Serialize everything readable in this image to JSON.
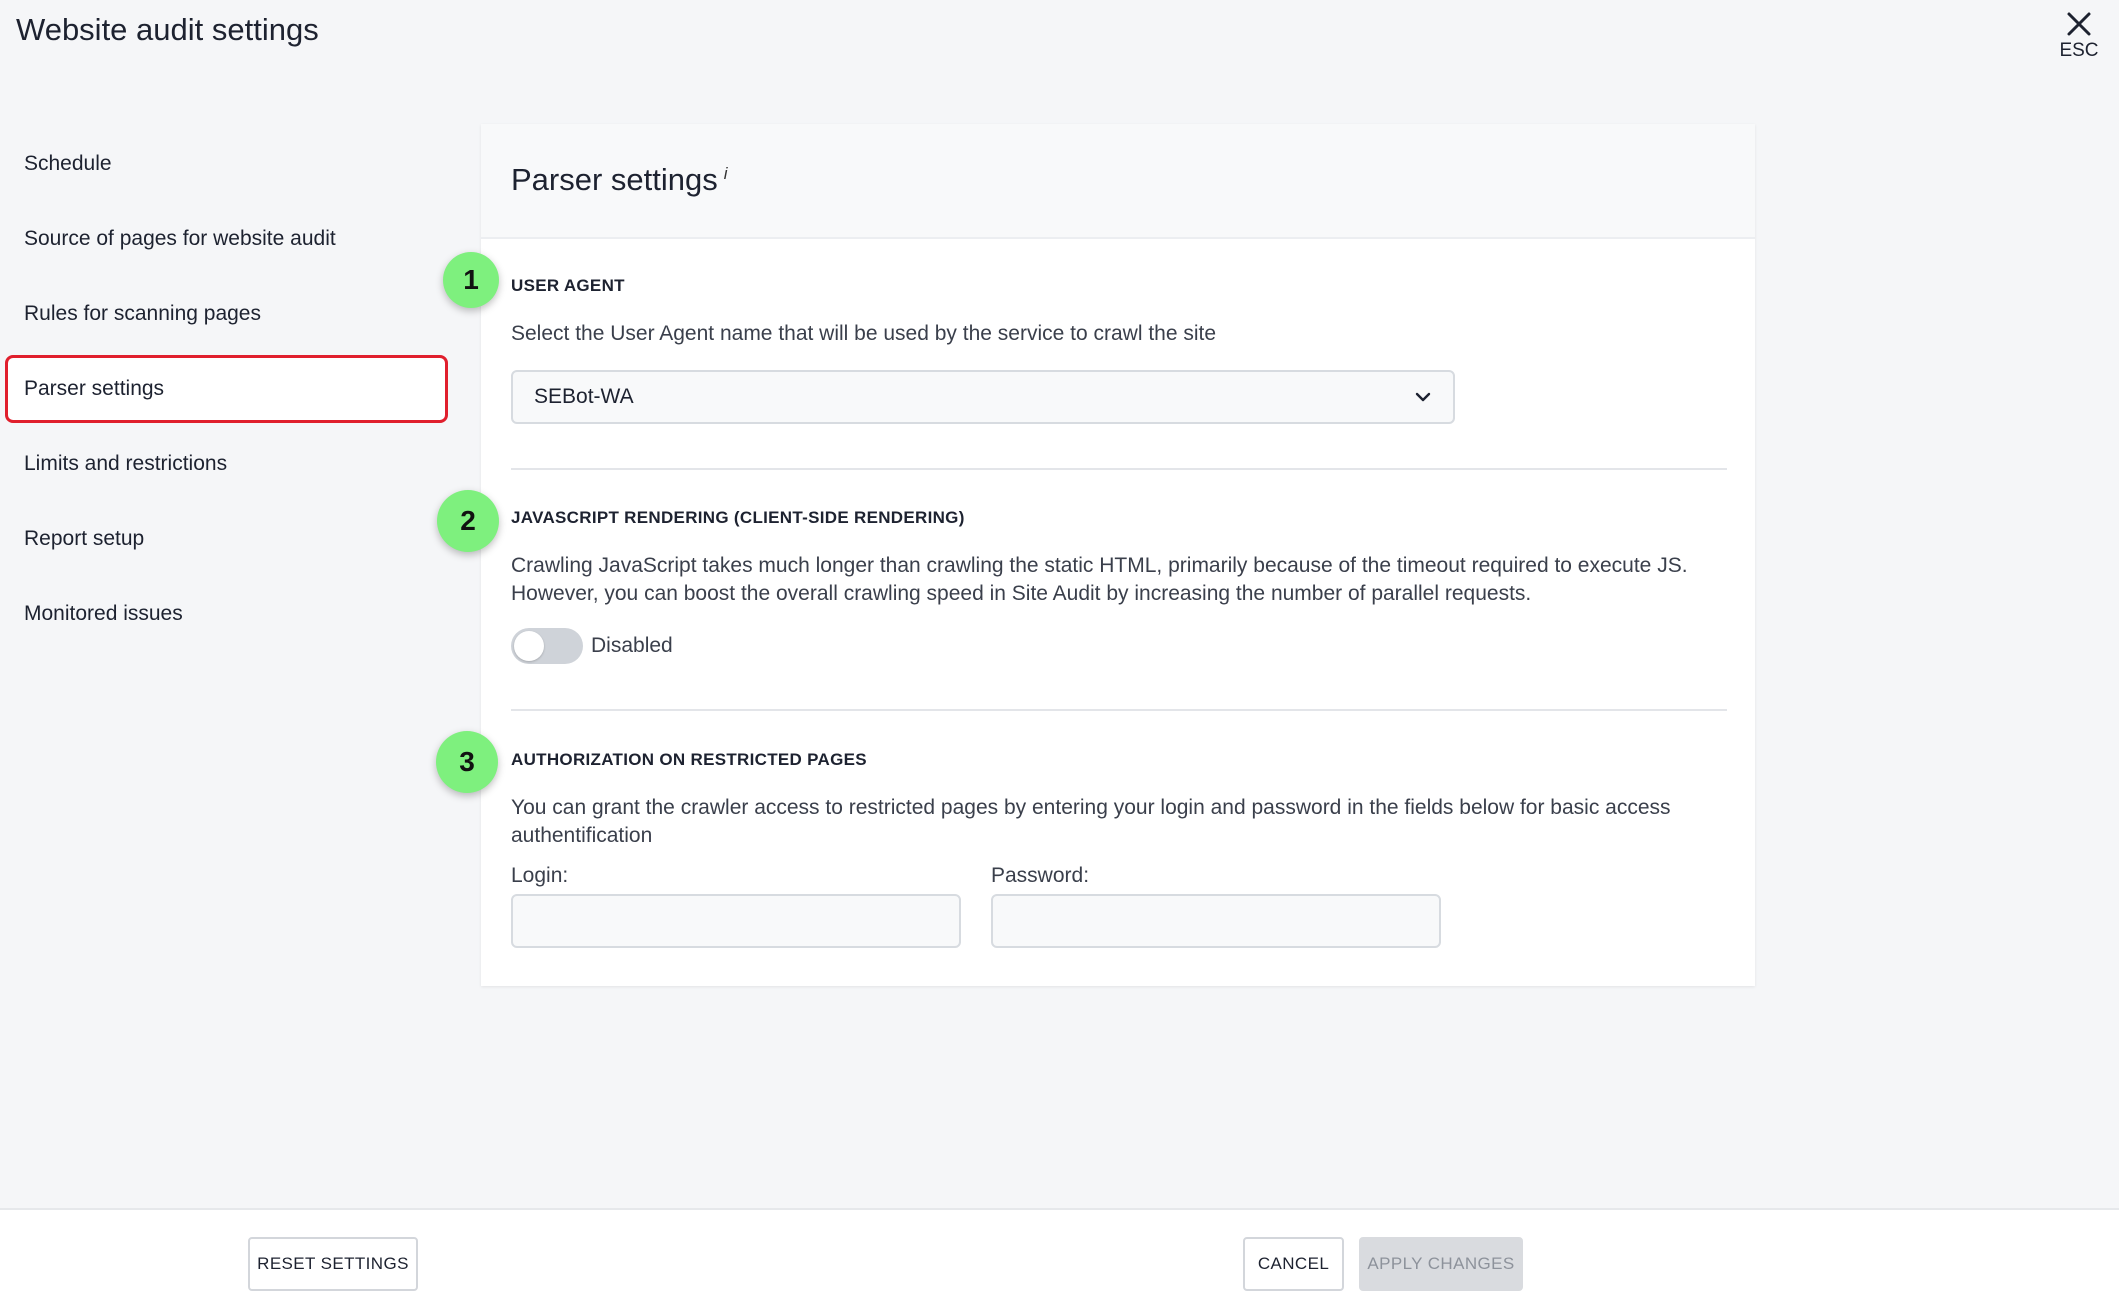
{
  "window": {
    "title": "Website audit settings",
    "close_icon": "close-icon",
    "close_hint": "ESC"
  },
  "sidebar": {
    "active_index": 3,
    "items": [
      {
        "label": "Schedule"
      },
      {
        "label": "Source of pages for website audit"
      },
      {
        "label": "Rules for scanning pages"
      },
      {
        "label": "Parser settings"
      },
      {
        "label": "Limits and restrictions"
      },
      {
        "label": "Report setup"
      },
      {
        "label": "Monitored issues"
      }
    ]
  },
  "panel": {
    "title": "Parser settings",
    "info_marker": "i",
    "sections": {
      "user_agent": {
        "badge": "1",
        "label": "USER AGENT",
        "description": "Select the User Agent name that will be used by the service to crawl the site",
        "selected_value": "SEBot-WA",
        "dropdown_icon": "chevron-down-icon"
      },
      "js_rendering": {
        "badge": "2",
        "label": "JAVASCRIPT RENDERING (CLIENT-SIDE RENDERING)",
        "description_line1": "Crawling JavaScript takes much longer than crawling the static HTML, primarily because of the timeout required to execute JS.",
        "description_line2": "However, you can boost the overall crawling speed in Site Audit by increasing the number of parallel requests.",
        "toggle_state": "Disabled",
        "toggle_on": false
      },
      "authorization": {
        "badge": "3",
        "label": "AUTHORIZATION ON RESTRICTED PAGES",
        "description": "You can grant the crawler access to restricted pages by entering your login and password in the fields below for basic access authentification",
        "login_label": "Login:",
        "login_value": "",
        "password_label": "Password:",
        "password_value": ""
      }
    }
  },
  "footer": {
    "reset_label": "RESET SETTINGS",
    "cancel_label": "CANCEL",
    "apply_label": "APPLY CHANGES",
    "apply_enabled": false
  },
  "colors": {
    "active_nav_border": "#e01f2d",
    "badge_fill": "#7ef07e",
    "disabled_button": "#d9dbdf"
  }
}
